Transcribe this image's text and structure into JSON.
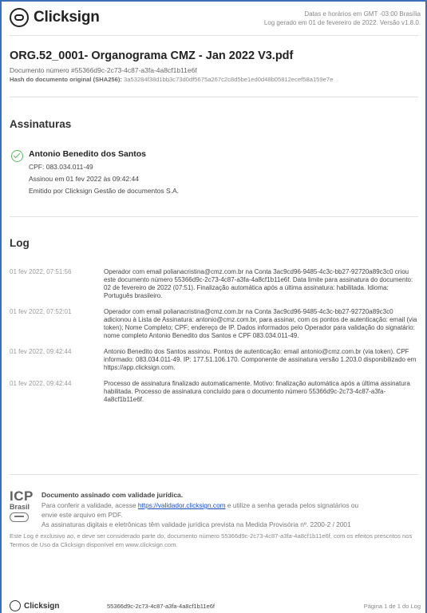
{
  "header": {
    "logo_text": "Clicksign",
    "timezone_note": "Datas e horários em GMT -03:00 Brasília",
    "generated_note": "Log gerado em 01 de fevereiro de 2022. Versão v1.8.0."
  },
  "document": {
    "title": "ORG.52_0001- Organograma CMZ - Jan 2022 V3.pdf",
    "number_line": "Documento número #55366d9c-2c73-4c87-a3fa-4a8cf1b11e6f",
    "hash_label": "Hash do documento original (SHA256):",
    "hash_value": "3a53284f38d1bb3c73d0df5675a267c2c8d5be1ed0d48b05812ecef58a159e7e"
  },
  "signatures": {
    "heading": "Assinaturas",
    "signer": {
      "name": "Antonio Benedito dos Santos",
      "cpf": "CPF: 083.034.011-49",
      "signed_at": "Assinou em 01 fev 2022 às 09:42:44",
      "issued_by": "Emitido por Clicksign Gestão de documentos S.A."
    }
  },
  "log": {
    "heading": "Log",
    "entries": [
      {
        "date": "01 fev 2022, 07:51:56",
        "text": "Operador com email polianacristina@cmz.com.br na Conta 3ac9cd96-9485-4c3c-bb27-92720a89c3c0 criou este documento número 55366d9c-2c73-4c87-a3fa-4a8cf1b11e6f. Data limite para assinatura do documento: 02 de fevereiro de 2022 (07:51). Finalização automática após a última assinatura: habilitada. Idioma: Português brasileiro."
      },
      {
        "date": "01 fev 2022, 07:52:01",
        "text": "Operador com email polianacristina@cmz.com.br na Conta 3ac9cd96-9485-4c3c-bb27-92720a89c3c0 adicionou à Lista de Assinatura: antonio@cmz.com.br, para assinar, com os pontos de autenticação: email (via token); Nome Completo; CPF; endereço de IP. Dados informados pelo Operador para validação do signatário: nome completo Antonio Benedito dos Santos e CPF 083.034.011-49."
      },
      {
        "date": "01 fev 2022, 09:42:44",
        "text": "Antonio Benedito dos Santos assinou. Pontos de autenticação: email antonio@cmz.com.br (via token). CPF informado: 083.034.011-49. IP: 177.51.106.170. Componente de assinatura versão 1.203.0 disponibilizado em https://app.clicksign.com."
      },
      {
        "date": "01 fev 2022, 09:42:44",
        "text": "Processo de assinatura finalizado automaticamente. Motivo: finalização automática após a última assinatura habilitada. Processo de assinatura concluído para o documento número 55366d9c-2c73-4c87-a3fa-4a8cf1b11e6f."
      }
    ]
  },
  "validation": {
    "icp_top": "ICP",
    "icp_bottom": "Brasil",
    "title": "Documento assinado com validade jurídica.",
    "line1_prefix": "Para conferir a validade, acesse",
    "link": "https://validador.clicksign.com",
    "line1_suffix": "e utilize a senha gerada pelos signatários ou",
    "line2": "envie este arquivo em PDF.",
    "line3": "As assinaturas digitais e eletrônicas têm validade jurídica prevista na Medida Provisória nº. 2200-2 / 2001"
  },
  "disclaimer": "Este Log é exclusivo ao, e deve ser considerado parte do, documento número 55366d9c-2c73-4c87-a3fa-4a8cf1b11e6f, com os efeitos prescritos nos Termos de Uso da Clicksign disponível em www.clicksign.com.",
  "footer": {
    "logo_text": "Clicksign",
    "hash": "55366d9c-2c73-4c87-a3fa-4a8cf1b11e6f",
    "page": "Página 1 de 1 do Log"
  }
}
